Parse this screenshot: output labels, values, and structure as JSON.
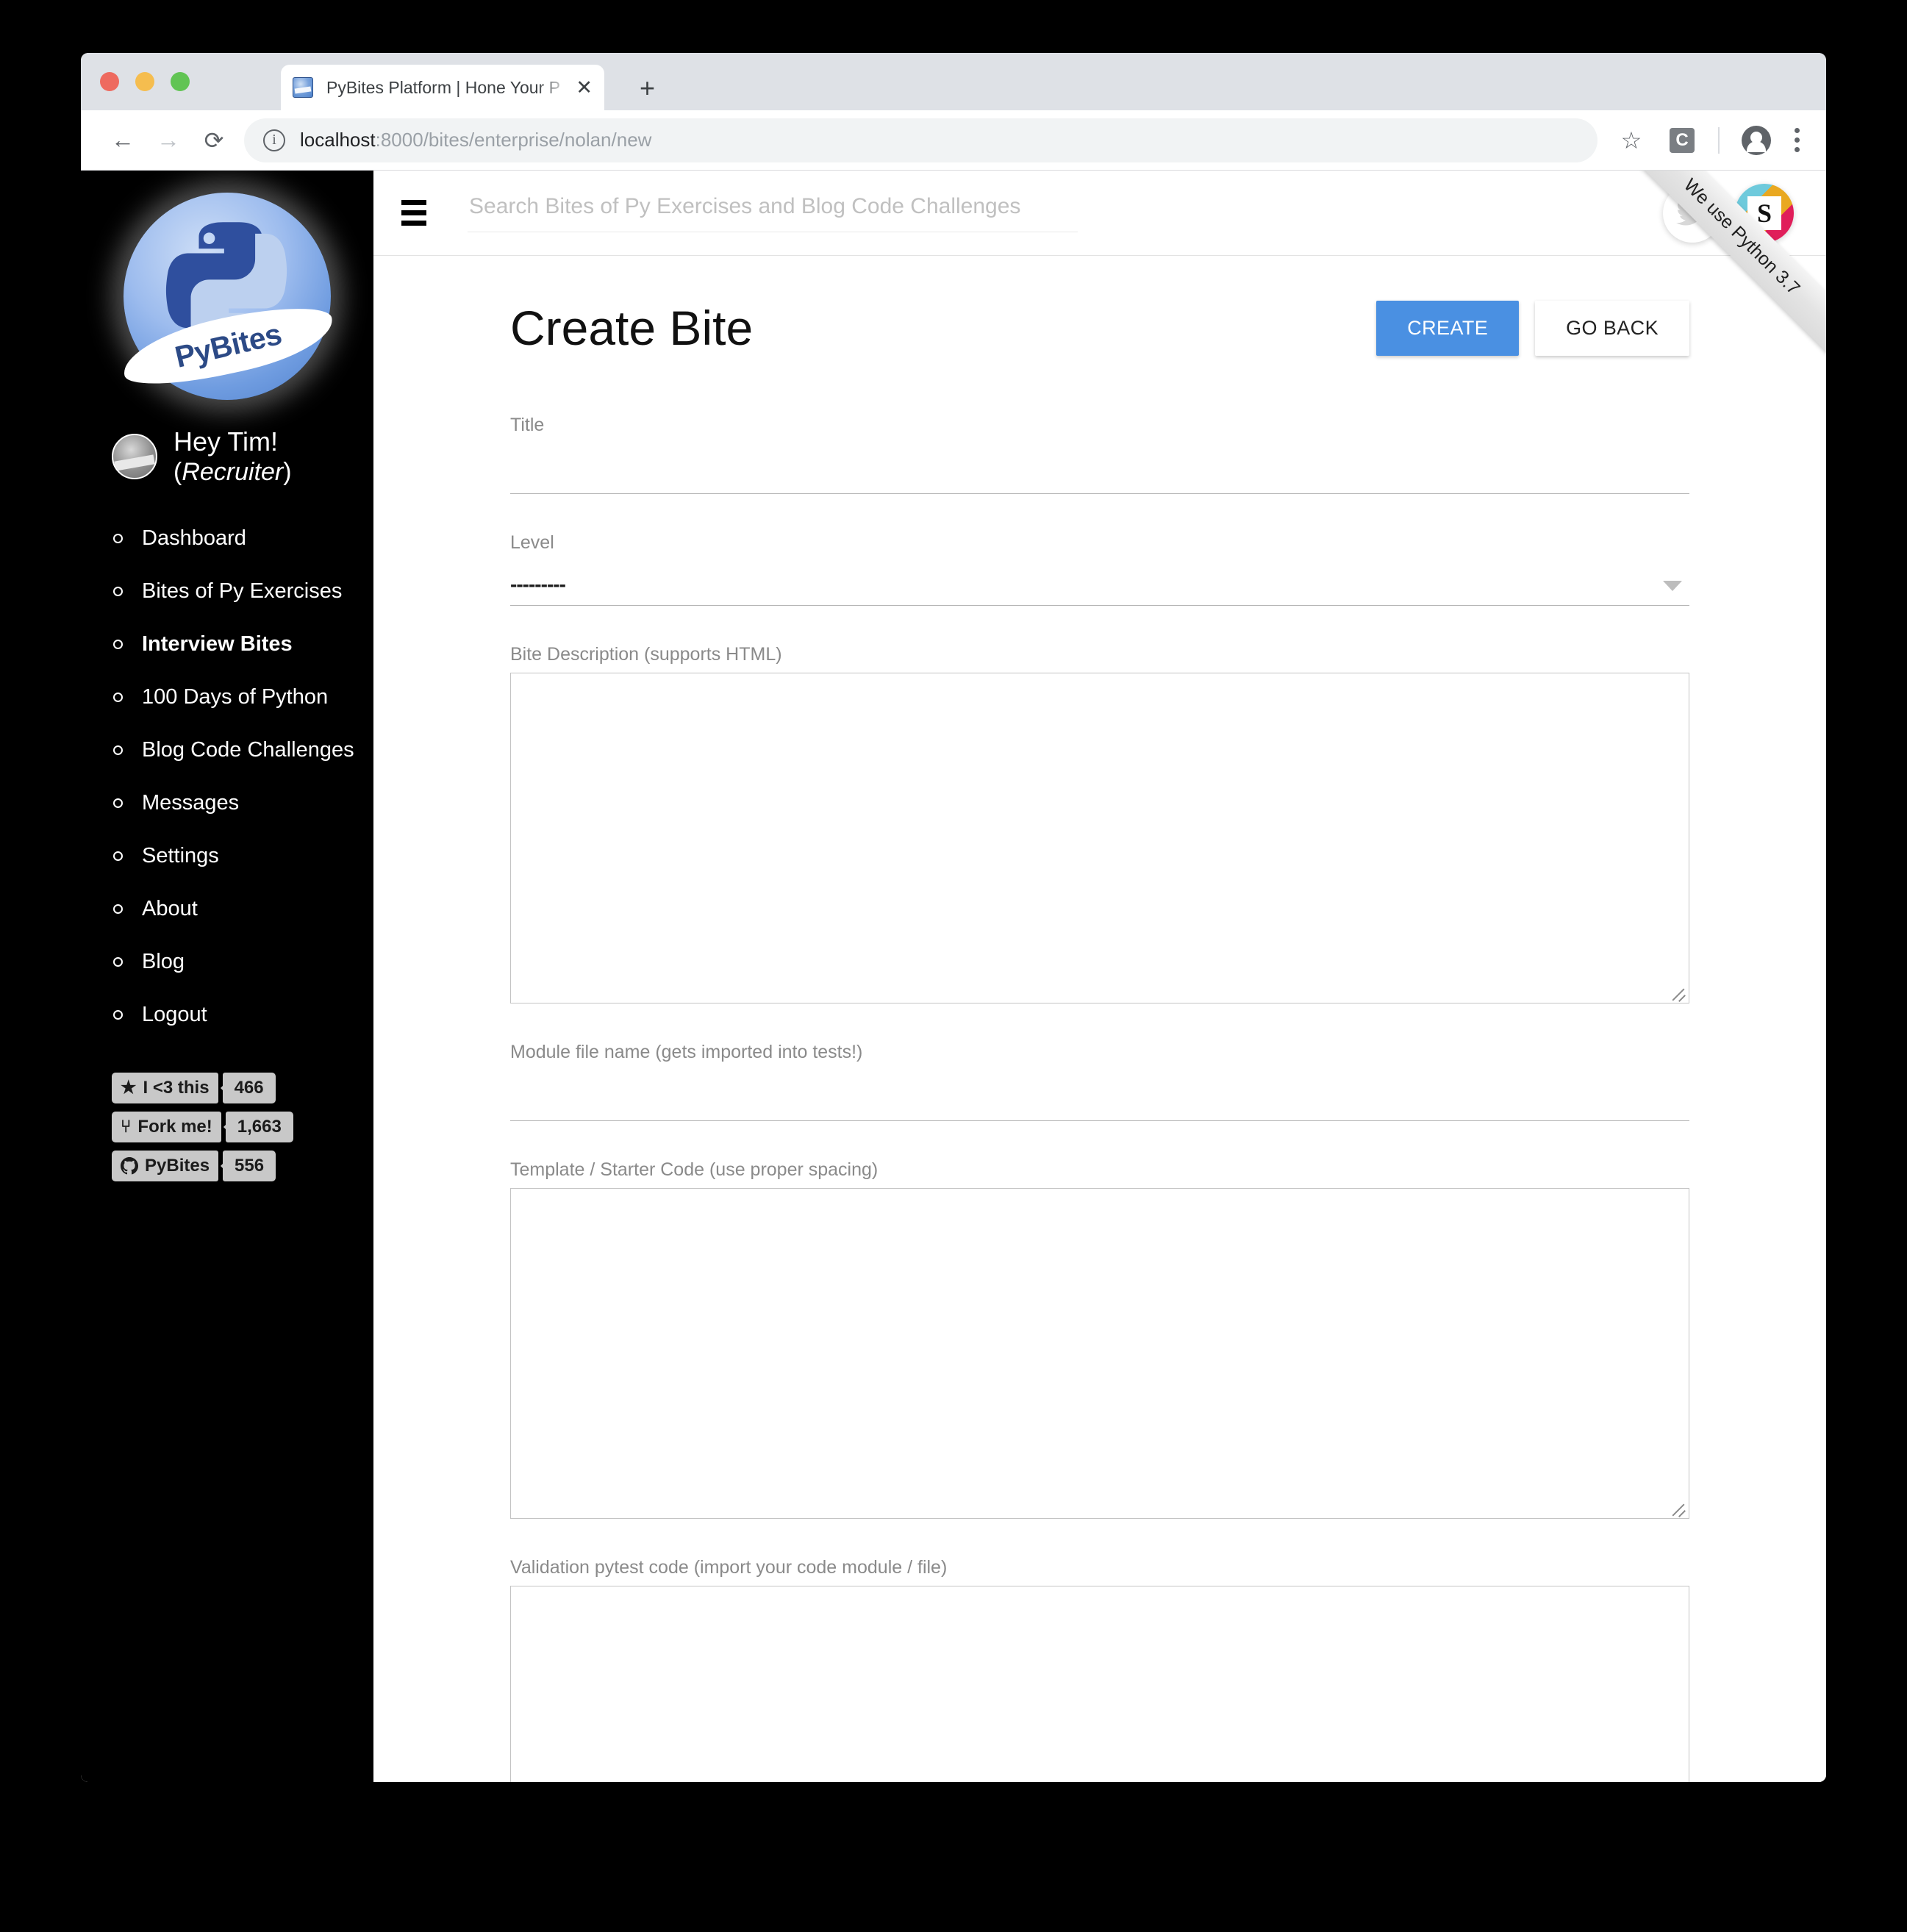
{
  "browser": {
    "tab": {
      "title": "PyBites Platform | Hone Your P",
      "close_label": "✕",
      "favicon_name": "pybites-favicon"
    },
    "new_tab_label": "+",
    "nav": {
      "back": "←",
      "forward": "→",
      "reload": "⟳"
    },
    "omnibox": {
      "info_icon": "ⓘ",
      "url_host": "localhost",
      "url_rest": ":8000/bites/enterprise/nolan/new"
    },
    "icons": {
      "bookmark": "☆",
      "extension": "C",
      "profile": "profile-avatar",
      "menu": "kebab-menu"
    }
  },
  "sidebar": {
    "logo_text": "PyBites",
    "greeting": "Hey Tim!",
    "role_open": "(",
    "role": "Recruiter",
    "role_close": ")",
    "nav_items": [
      {
        "label": "Dashboard",
        "active": false
      },
      {
        "label": "Bites of Py Exercises",
        "active": false
      },
      {
        "label": "Interview Bites",
        "active": true
      },
      {
        "label": "100 Days of Python",
        "active": false
      },
      {
        "label": "Blog Code Challenges",
        "active": false
      },
      {
        "label": "Messages",
        "active": false
      },
      {
        "label": "Settings",
        "active": false
      },
      {
        "label": "About",
        "active": false
      },
      {
        "label": "Blog",
        "active": false
      },
      {
        "label": "Logout",
        "active": false
      }
    ],
    "badges": [
      {
        "icon": "★",
        "label": "I <3 this",
        "count": "466"
      },
      {
        "icon": "⑂",
        "label": "Fork me!",
        "count": "1,663"
      },
      {
        "icon": "",
        "label": "PyBites",
        "count": "556"
      }
    ]
  },
  "topbar": {
    "menu_icon": "hamburger-icon",
    "search_placeholder": "Search Bites of Py Exercises and Blog Code Challenges",
    "search_value": "",
    "twitter_icon": "twitter-bird",
    "slack_letter": "S"
  },
  "ribbon": {
    "text": "We use Python 3.7"
  },
  "main": {
    "title": "Create Bite",
    "create_label": "CREATE",
    "go_back_label": "GO BACK",
    "fields": {
      "title": {
        "label": "Title",
        "value": ""
      },
      "level": {
        "label": "Level",
        "selected": "---------"
      },
      "description": {
        "label": "Bite Description (supports HTML)",
        "value": ""
      },
      "module": {
        "label": "Module file name (gets imported into tests!)",
        "value": ""
      },
      "template": {
        "label": "Template / Starter Code (use proper spacing)",
        "value": ""
      },
      "pytest": {
        "label": "Validation pytest code (import your code module / file)",
        "value": ""
      }
    }
  },
  "colors": {
    "accent": "#4a90e2",
    "sidebar_bg": "#000000",
    "label_gray": "#8a8a8a"
  }
}
